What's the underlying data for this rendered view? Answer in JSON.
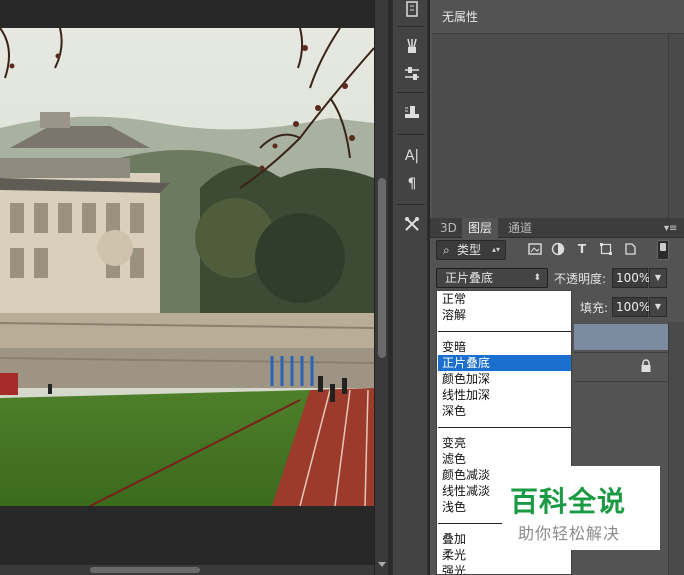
{
  "properties_panel": {
    "title": "无属性"
  },
  "layers_panel": {
    "tabs": [
      {
        "label": "3D",
        "active": false
      },
      {
        "label": "图层",
        "active": true
      },
      {
        "label": "通道",
        "active": false
      }
    ],
    "menu_glyph": "▾≡",
    "filter": {
      "kind_label": "类型",
      "kind_icon": "search-icon",
      "filter_icons": [
        "image-filter-icon",
        "adjustment-filter-icon",
        "type-filter-icon",
        "shape-filter-icon",
        "smart-object-filter-icon"
      ]
    },
    "blend_mode": {
      "selected": "正片叠底"
    },
    "opacity": {
      "label": "不透明度:",
      "value": "100%"
    },
    "fill": {
      "label": "填充:",
      "value": "100%"
    }
  },
  "blend_menu": {
    "items": [
      "正常",
      "溶解",
      "变暗",
      "正片叠底",
      "颜色加深",
      "线性加深",
      "深色",
      "变亮",
      "滤色",
      "颜色减淡",
      "线性减淡",
      "浅色",
      "叠加",
      "柔光",
      "强光"
    ],
    "selected": "正片叠底",
    "highlight_color": "#1b6fce"
  },
  "toolstrip": {
    "icons": [
      "history-icon",
      "brush-presets-icon",
      "adjustments-icon",
      "clone-source-icon",
      "character-icon",
      "paragraph-icon",
      "tool-presets-icon"
    ],
    "glyphs": {
      "character": "A|",
      "paragraph": "¶"
    }
  },
  "watermark": {
    "title": "百科全说",
    "subtitle": "助你轻松解决",
    "color": "#1b9a44"
  }
}
